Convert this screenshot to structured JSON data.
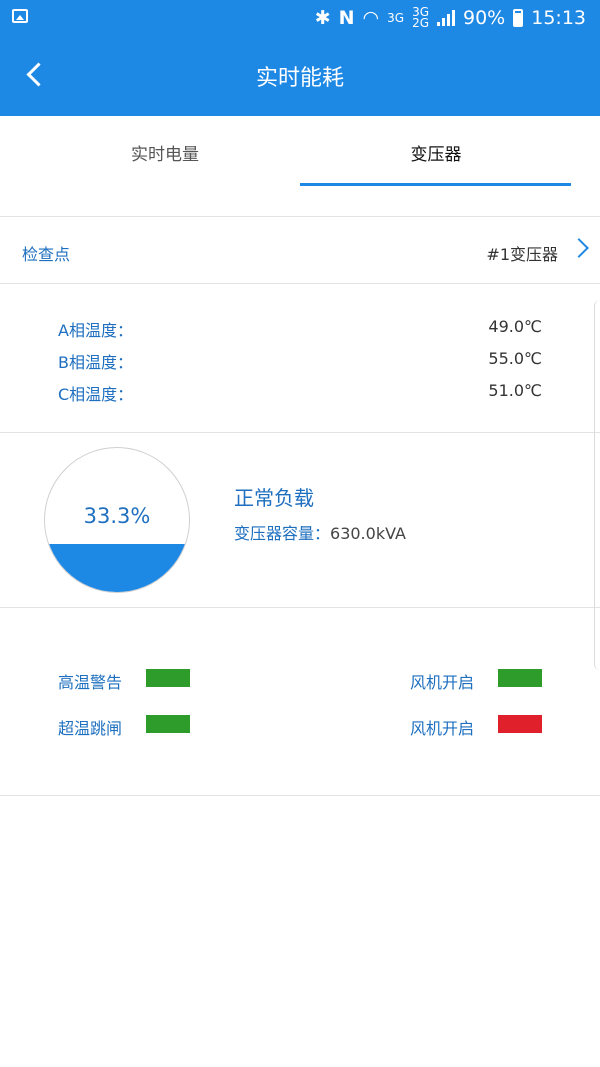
{
  "status_bar": {
    "icons": [
      "image-icon",
      "bluetooth-icon",
      "nfc-icon",
      "wifi-icon",
      "signal-icon",
      "battery-icon"
    ],
    "net1": "3G",
    "net2": "3G",
    "net3": "2G",
    "battery": "90%",
    "time": "15:13"
  },
  "app_bar": {
    "title": "实时能耗"
  },
  "tabs": [
    {
      "label": "实时电量",
      "active": false
    },
    {
      "label": "变压器",
      "active": true
    }
  ],
  "checkpoint": {
    "label": "检查点",
    "value": "#1变压器"
  },
  "temperatures": [
    {
      "label": "A相温度：",
      "value": "49.0℃"
    },
    {
      "label": "B相温度：",
      "value": "55.0℃"
    },
    {
      "label": "C相温度：",
      "value": "51.0℃"
    }
  ],
  "load": {
    "percent_text": "33.3%",
    "percent": 0.333,
    "status": "正常负载",
    "capacity_label": "变压器容量：",
    "capacity_value": "630.0kVA"
  },
  "alarms": [
    {
      "left": {
        "label": "高温警告",
        "color": "#2e9c2a"
      },
      "right": {
        "label": "风机开启",
        "color": "#2e9c2a"
      }
    },
    {
      "left": {
        "label": "超温跳闸",
        "color": "#2e9c2a"
      },
      "right": {
        "label": "风机开启",
        "color": "#e0202a"
      }
    }
  ],
  "colors": {
    "primary": "#1e88e5",
    "ok": "#2e9c2a",
    "alarm": "#e0202a"
  }
}
